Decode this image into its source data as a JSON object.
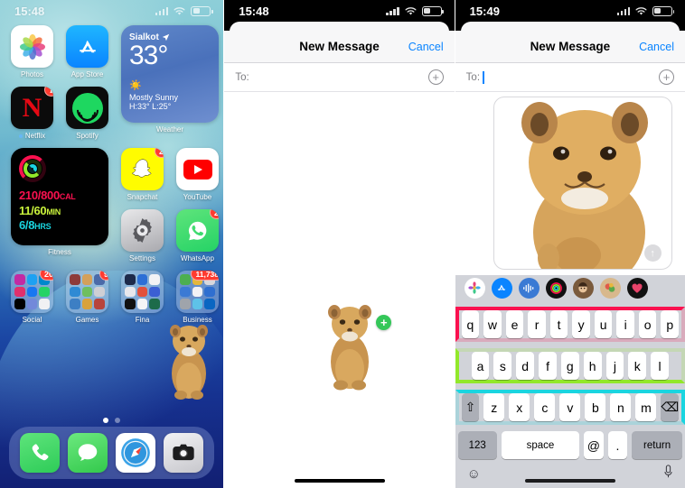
{
  "home": {
    "status": {
      "time": "15:48",
      "signal_icon": "cellular-signal-icon",
      "wifi_icon": "wifi-icon",
      "battery_icon": "battery-icon"
    },
    "apps_row1": [
      {
        "label": "Photos",
        "name": "photos"
      },
      {
        "label": "App Store",
        "name": "app-store"
      }
    ],
    "apps_row2": [
      {
        "label": "Netflix",
        "name": "netflix",
        "badge": "1",
        "dot": true
      },
      {
        "label": "Spotify",
        "name": "spotify",
        "badge": ""
      }
    ],
    "weather": {
      "location": "Sialkot",
      "temperature": "33°",
      "condition": "Mostly Sunny",
      "highlow": "H:33° L:25°",
      "label": "Weather",
      "sun_icon": "sun-icon",
      "location_arrow_icon": "location-arrow-icon"
    },
    "fitness": {
      "move": "210/800",
      "move_unit": "CAL",
      "exercise": "11/60",
      "exercise_unit": "MIN",
      "stand": "6/8",
      "stand_unit": "HRS",
      "label": "Fitness"
    },
    "apps_row3": [
      {
        "label": "Snapchat",
        "name": "snapchat",
        "badge": "2"
      },
      {
        "label": "YouTube",
        "name": "youtube",
        "badge": ""
      }
    ],
    "apps_row4": [
      {
        "label": "Settings",
        "name": "settings",
        "badge": ""
      },
      {
        "label": "WhatsApp",
        "name": "whatsapp",
        "badge": "2"
      }
    ],
    "folders": [
      {
        "label": "Social",
        "badge": "20"
      },
      {
        "label": "Games",
        "badge": "9"
      },
      {
        "label": "Fina",
        "badge": ""
      },
      {
        "label": "Business",
        "badge": "11,738"
      }
    ],
    "dock": [
      {
        "label": "Phone",
        "name": "phone"
      },
      {
        "label": "Messages",
        "name": "messages"
      },
      {
        "label": "Safari",
        "name": "safari"
      },
      {
        "label": "Camera",
        "name": "camera"
      }
    ],
    "page_dots": {
      "count": 2,
      "active": 1
    },
    "sticker_subject": "lion-cub"
  },
  "middle": {
    "status": {
      "time": "15:48"
    },
    "nav": {
      "title": "New Message",
      "cancel": "Cancel"
    },
    "to_field": {
      "label": "To:",
      "value": "",
      "add_contact_icon": "plus-circle-icon"
    },
    "sticker": {
      "subject": "lion-cub-sticker",
      "add_badge": "+"
    },
    "side_tab_icon": "chevron-right-icon"
  },
  "right": {
    "status": {
      "time": "15:49"
    },
    "nav": {
      "title": "New Message",
      "cancel": "Cancel"
    },
    "to_field": {
      "label": "To:",
      "value": "",
      "add_contact_icon": "plus-circle-icon"
    },
    "sticker": {
      "subject": "lion-cub-sticker",
      "send_icon": "send-arrow-up-icon"
    },
    "side_tab_icon": "chevron-right-icon",
    "imessage_apps": [
      {
        "name": "photos-app-icon"
      },
      {
        "name": "app-store-app-icon"
      },
      {
        "name": "audio-message-app-icon"
      },
      {
        "name": "fitness-app-icon"
      },
      {
        "name": "memoji-app-icon"
      },
      {
        "name": "stickers-app-icon"
      },
      {
        "name": "digital-touch-app-icon"
      }
    ],
    "keyboard": {
      "row1": [
        "q",
        "w",
        "e",
        "r",
        "t",
        "y",
        "u",
        "i",
        "o",
        "p"
      ],
      "row2": [
        "a",
        "s",
        "d",
        "f",
        "g",
        "h",
        "j",
        "k",
        "l"
      ],
      "row3_letters": [
        "z",
        "x",
        "c",
        "v",
        "b",
        "n",
        "m"
      ],
      "shift": "⇧",
      "backspace": "⌫",
      "numbers": "123",
      "space": "space",
      "at": "@",
      "period": ".",
      "return": "return",
      "emoji_icon": "emoji-smiley-icon",
      "mic_icon": "microphone-icon"
    }
  },
  "colors": {
    "accent_blue": "#0a84ff",
    "green_badge": "#34c759",
    "red_badge": "#ff3b30",
    "keyboard_bg": "#d1d3d9"
  }
}
